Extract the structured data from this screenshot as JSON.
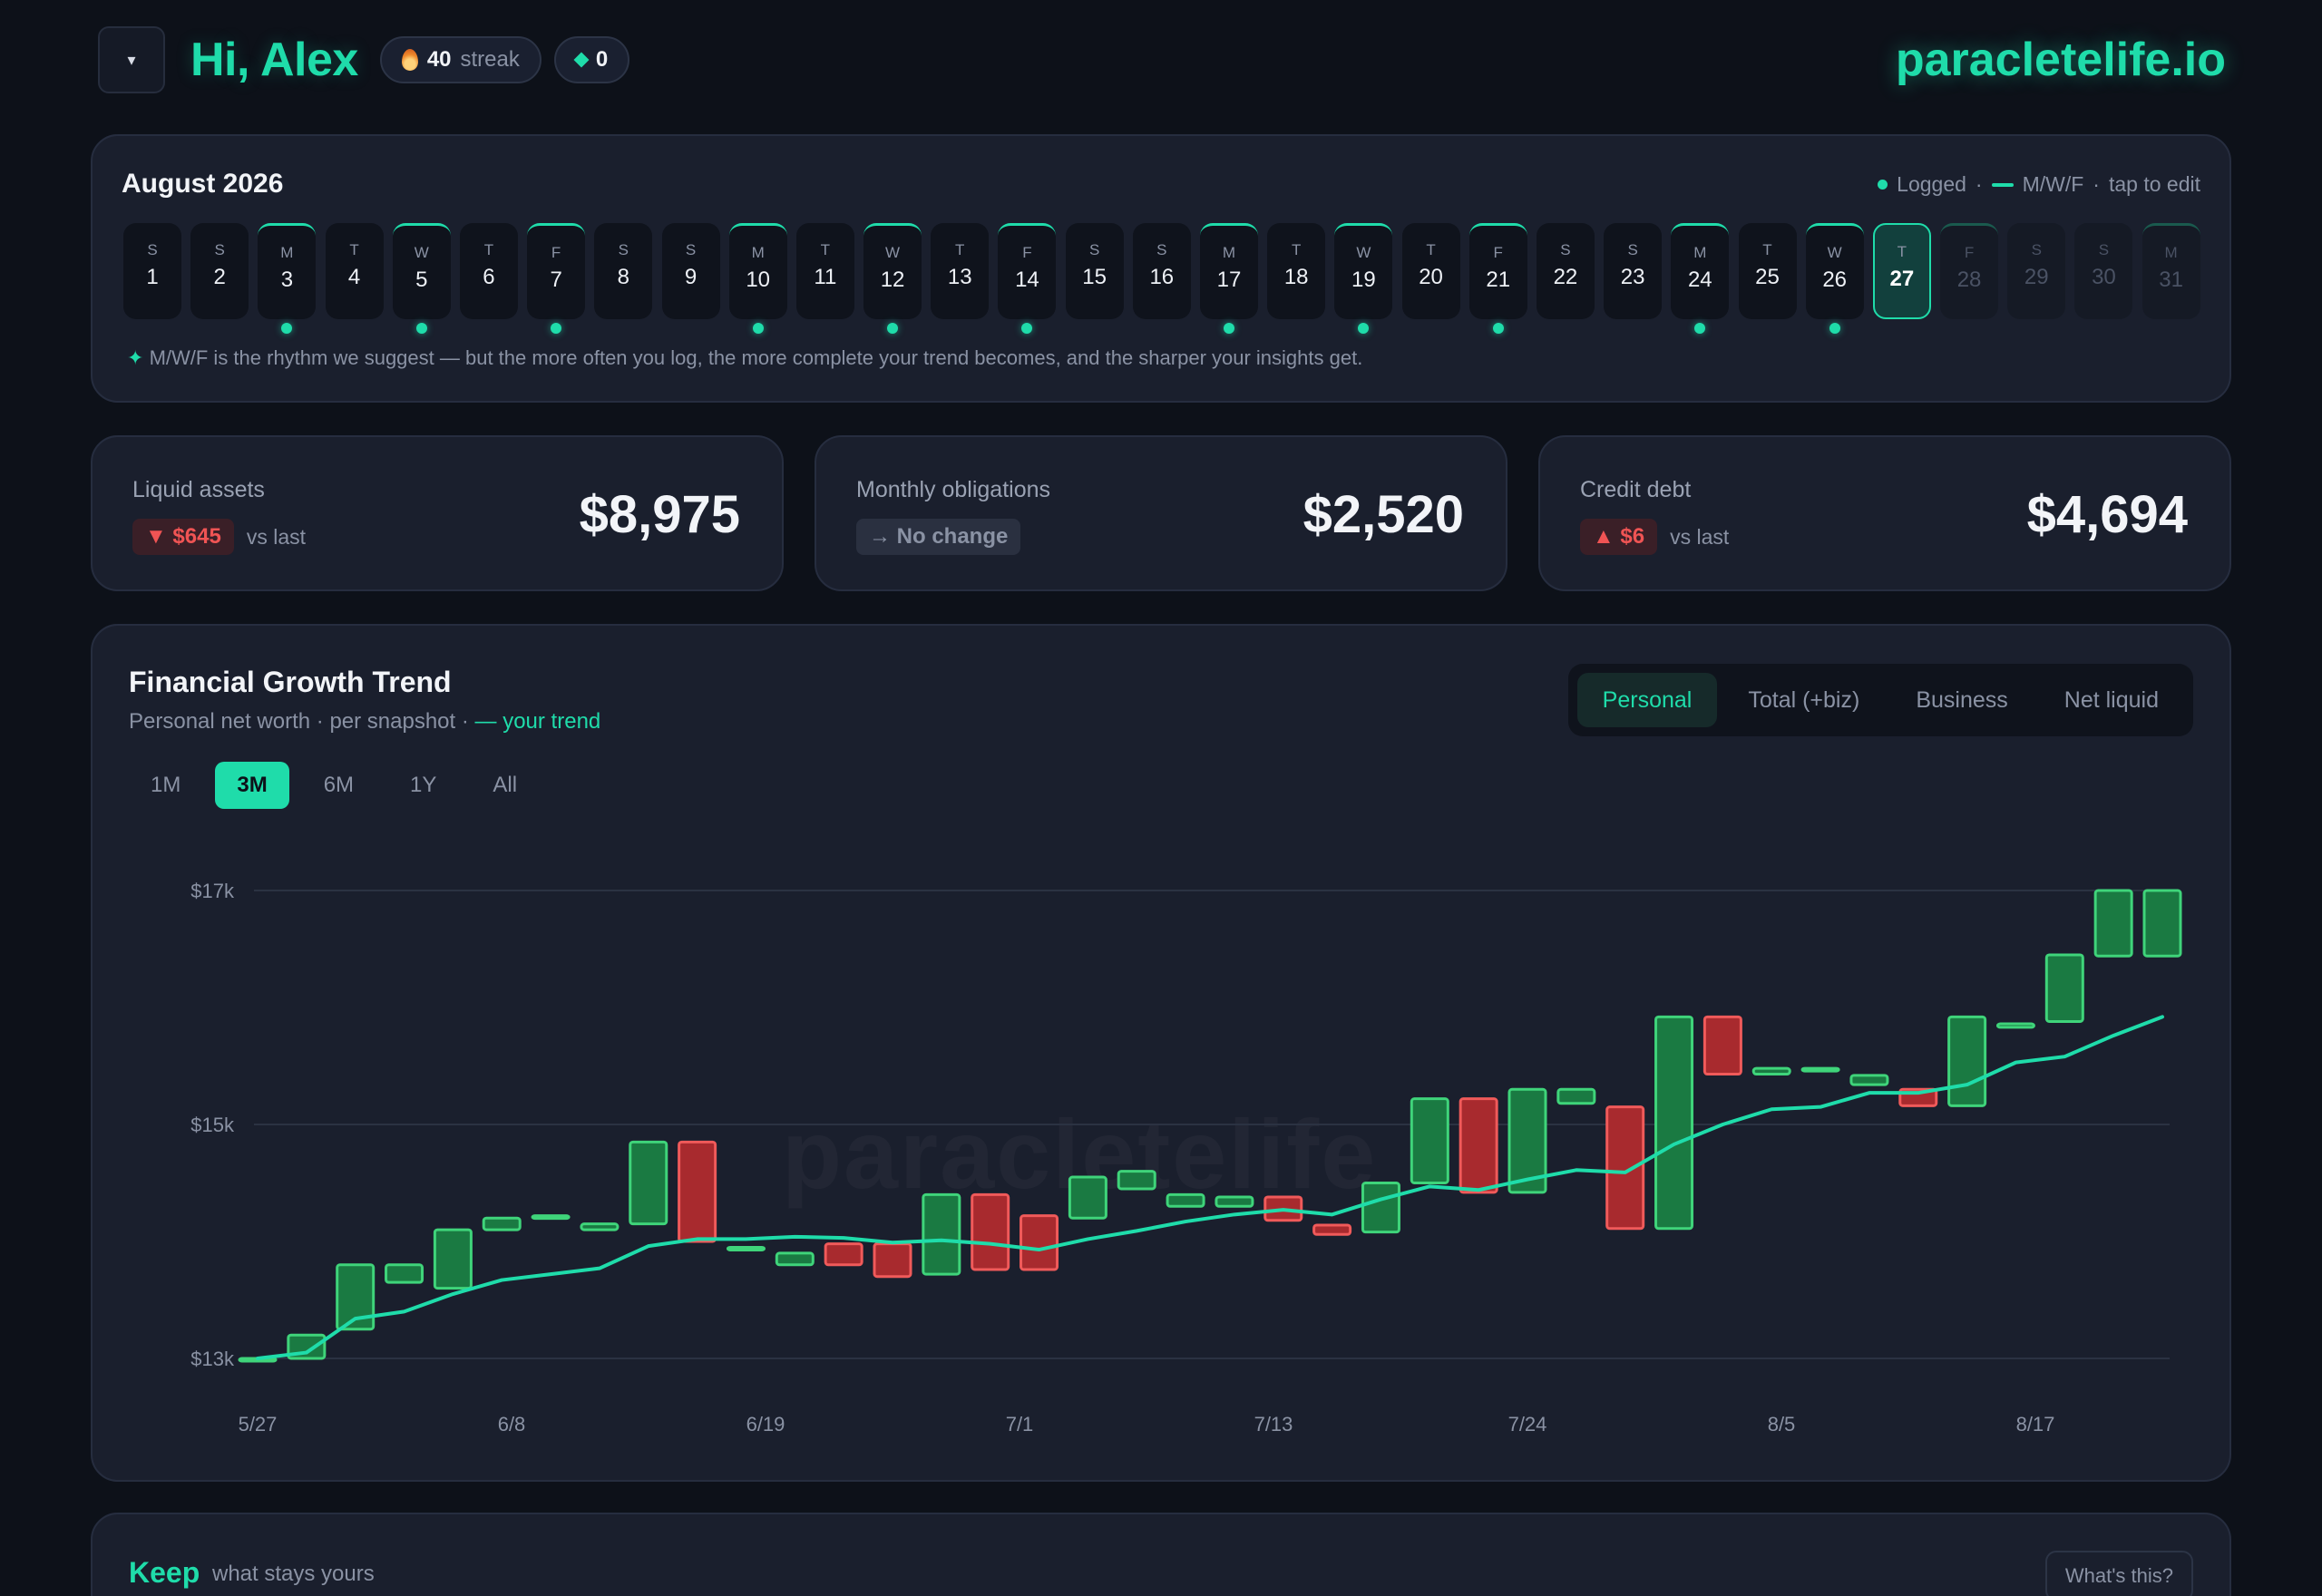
{
  "header": {
    "greeting": "Hi, Alex",
    "streak_count": "40",
    "streak_label": "streak",
    "gems_count": "0",
    "brand": "paracletelife.io",
    "menu_glyph": "▾"
  },
  "calendar": {
    "title": "August 2026",
    "legend_logged": "Logged",
    "legend_mwf": "M/W/F",
    "legend_edit": "tap to edit",
    "separator": "·",
    "note_star": "✦",
    "note": "M/W/F is the rhythm we suggest — but the more often you log, the more complete your trend becomes, and the sharper your insights get.",
    "days": [
      {
        "l": "S",
        "n": "1",
        "mwf": false,
        "logged": false,
        "state": "past"
      },
      {
        "l": "S",
        "n": "2",
        "mwf": false,
        "logged": false,
        "state": "past"
      },
      {
        "l": "M",
        "n": "3",
        "mwf": true,
        "logged": true,
        "state": "past"
      },
      {
        "l": "T",
        "n": "4",
        "mwf": false,
        "logged": false,
        "state": "past"
      },
      {
        "l": "W",
        "n": "5",
        "mwf": true,
        "logged": true,
        "state": "past"
      },
      {
        "l": "T",
        "n": "6",
        "mwf": false,
        "logged": false,
        "state": "past"
      },
      {
        "l": "F",
        "n": "7",
        "mwf": true,
        "logged": true,
        "state": "past"
      },
      {
        "l": "S",
        "n": "8",
        "mwf": false,
        "logged": false,
        "state": "past"
      },
      {
        "l": "S",
        "n": "9",
        "mwf": false,
        "logged": false,
        "state": "past"
      },
      {
        "l": "M",
        "n": "10",
        "mwf": true,
        "logged": true,
        "state": "past"
      },
      {
        "l": "T",
        "n": "11",
        "mwf": false,
        "logged": false,
        "state": "past"
      },
      {
        "l": "W",
        "n": "12",
        "mwf": true,
        "logged": true,
        "state": "past"
      },
      {
        "l": "T",
        "n": "13",
        "mwf": false,
        "logged": false,
        "state": "past"
      },
      {
        "l": "F",
        "n": "14",
        "mwf": true,
        "logged": true,
        "state": "past"
      },
      {
        "l": "S",
        "n": "15",
        "mwf": false,
        "logged": false,
        "state": "past"
      },
      {
        "l": "S",
        "n": "16",
        "mwf": false,
        "logged": false,
        "state": "past"
      },
      {
        "l": "M",
        "n": "17",
        "mwf": true,
        "logged": true,
        "state": "past"
      },
      {
        "l": "T",
        "n": "18",
        "mwf": false,
        "logged": false,
        "state": "past"
      },
      {
        "l": "W",
        "n": "19",
        "mwf": true,
        "logged": true,
        "state": "past"
      },
      {
        "l": "T",
        "n": "20",
        "mwf": false,
        "logged": false,
        "state": "past"
      },
      {
        "l": "F",
        "n": "21",
        "mwf": true,
        "logged": true,
        "state": "past"
      },
      {
        "l": "S",
        "n": "22",
        "mwf": false,
        "logged": false,
        "state": "past"
      },
      {
        "l": "S",
        "n": "23",
        "mwf": false,
        "logged": false,
        "state": "past"
      },
      {
        "l": "M",
        "n": "24",
        "mwf": true,
        "logged": true,
        "state": "past"
      },
      {
        "l": "T",
        "n": "25",
        "mwf": false,
        "logged": false,
        "state": "past"
      },
      {
        "l": "W",
        "n": "26",
        "mwf": true,
        "logged": true,
        "state": "past"
      },
      {
        "l": "T",
        "n": "27",
        "mwf": false,
        "logged": false,
        "state": "today"
      },
      {
        "l": "F",
        "n": "28",
        "mwf": true,
        "logged": false,
        "state": "future"
      },
      {
        "l": "S",
        "n": "29",
        "mwf": false,
        "logged": false,
        "state": "future"
      },
      {
        "l": "S",
        "n": "30",
        "mwf": false,
        "logged": false,
        "state": "future"
      },
      {
        "l": "M",
        "n": "31",
        "mwf": true,
        "logged": false,
        "state": "future"
      }
    ]
  },
  "stats": {
    "liquid": {
      "label": "Liquid assets",
      "value": "$8,975",
      "change": "▼ $645",
      "change_suffix": "vs last"
    },
    "obligations": {
      "label": "Monthly obligations",
      "value": "$2,520",
      "change": "→ No change"
    },
    "credit": {
      "label": "Credit debt",
      "value": "$4,694",
      "change": "▲ $6",
      "change_suffix": "vs last"
    }
  },
  "trend": {
    "title": "Financial Growth Trend",
    "subtitle": "Personal net worth · per snapshot · ",
    "subtitle_accent": "— your trend",
    "tabs": [
      "Personal",
      "Total (+biz)",
      "Business",
      "Net liquid"
    ],
    "active_tab": 0,
    "ranges": [
      "1M",
      "3M",
      "6M",
      "1Y",
      "All"
    ],
    "active_range": 1,
    "watermark": "paracletelife"
  },
  "colors": {
    "accent": "#1fdcaa",
    "up_fill": "#1a7a42",
    "up_stroke": "#3fd47a",
    "down_fill": "#a82a2e",
    "down_stroke": "#f05a5a"
  },
  "chart_data": {
    "type": "candlestick",
    "y_ticks": [
      "$17k",
      "$15k",
      "$13k"
    ],
    "y_tick_values": [
      17000,
      15000,
      13000
    ],
    "ylim": [
      13000,
      17000
    ],
    "x_ticks": [
      "5/27",
      "6/8",
      "6/19",
      "7/1",
      "7/13",
      "7/24",
      "8/5",
      "8/17"
    ],
    "x_tick_index": [
      0,
      5.2,
      10.4,
      15.6,
      20.8,
      26.0,
      31.2,
      36.4
    ],
    "candles": [
      {
        "open": 13000,
        "close": 13000
      },
      {
        "open": 13000,
        "close": 13200
      },
      {
        "open": 13250,
        "close": 13800
      },
      {
        "open": 13650,
        "close": 13800
      },
      {
        "open": 13600,
        "close": 14100
      },
      {
        "open": 14100,
        "close": 14200
      },
      {
        "open": 14200,
        "close": 14220
      },
      {
        "open": 14100,
        "close": 14150
      },
      {
        "open": 14150,
        "close": 14850
      },
      {
        "open": 14850,
        "close": 14000
      },
      {
        "open": 13950,
        "close": 13950
      },
      {
        "open": 13800,
        "close": 13900
      },
      {
        "open": 13980,
        "close": 13800
      },
      {
        "open": 13980,
        "close": 13700
      },
      {
        "open": 13720,
        "close": 14400
      },
      {
        "open": 14400,
        "close": 13760
      },
      {
        "open": 14220,
        "close": 13760
      },
      {
        "open": 14200,
        "close": 14550
      },
      {
        "open": 14450,
        "close": 14600
      },
      {
        "open": 14300,
        "close": 14400
      },
      {
        "open": 14300,
        "close": 14380
      },
      {
        "open": 14380,
        "close": 14180
      },
      {
        "open": 14140,
        "close": 14060
      },
      {
        "open": 14080,
        "close": 14500
      },
      {
        "open": 14500,
        "close": 15220
      },
      {
        "open": 15220,
        "close": 14420
      },
      {
        "open": 14420,
        "close": 15300
      },
      {
        "open": 15180,
        "close": 15300
      },
      {
        "open": 15150,
        "close": 14110
      },
      {
        "open": 14110,
        "close": 15920
      },
      {
        "open": 15920,
        "close": 15430
      },
      {
        "open": 15430,
        "close": 15480
      },
      {
        "open": 15470,
        "close": 15480
      },
      {
        "open": 15340,
        "close": 15420
      },
      {
        "open": 15300,
        "close": 15160
      },
      {
        "open": 15160,
        "close": 15920
      },
      {
        "open": 15830,
        "close": 15860
      },
      {
        "open": 15880,
        "close": 16450
      },
      {
        "open": 16440,
        "close": 17000
      },
      {
        "open": 16440,
        "close": 17000
      }
    ],
    "trend_line": [
      13000,
      13050,
      13340,
      13400,
      13550,
      13670,
      13720,
      13770,
      13960,
      14020,
      14020,
      14040,
      14030,
      13990,
      14010,
      13980,
      13930,
      14020,
      14090,
      14170,
      14230,
      14270,
      14230,
      14360,
      14470,
      14440,
      14530,
      14610,
      14590,
      14830,
      15000,
      15130,
      15150,
      15270,
      15270,
      15340,
      15530,
      15580,
      15760,
      15920
    ]
  }
}
